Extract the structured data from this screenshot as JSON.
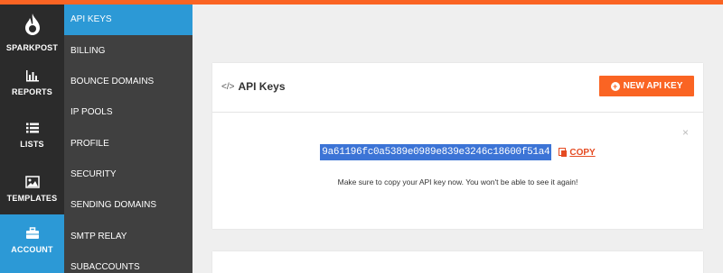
{
  "brand": {
    "name": "SPARKPOST",
    "accent": "#fa6423",
    "active_blue": "#2c99d6"
  },
  "primary_nav": {
    "logo_label": "SPARKPOST",
    "reports": "REPORTS",
    "lists": "LISTS",
    "templates": "TEMPLATES",
    "account": "ACCOUNT"
  },
  "secondary_nav": {
    "items": [
      {
        "label": "API KEYS",
        "active": true
      },
      {
        "label": "BILLING"
      },
      {
        "label": "BOUNCE DOMAINS"
      },
      {
        "label": "IP POOLS"
      },
      {
        "label": "PROFILE"
      },
      {
        "label": "SECURITY"
      },
      {
        "label": "SENDING DOMAINS"
      },
      {
        "label": "SMTP RELAY"
      },
      {
        "label": "SUBACCOUNTS"
      }
    ]
  },
  "panel": {
    "icon_glyph": "</>",
    "title": "API Keys",
    "new_key_button": "NEW API KEY",
    "close_glyph": "×",
    "api_key": "9a61196fc0a5389e0989e839e3246c18600f51a4",
    "copy_label": "COPY",
    "notice": "Make sure to copy your API key now. You won't be able to see it again!"
  }
}
